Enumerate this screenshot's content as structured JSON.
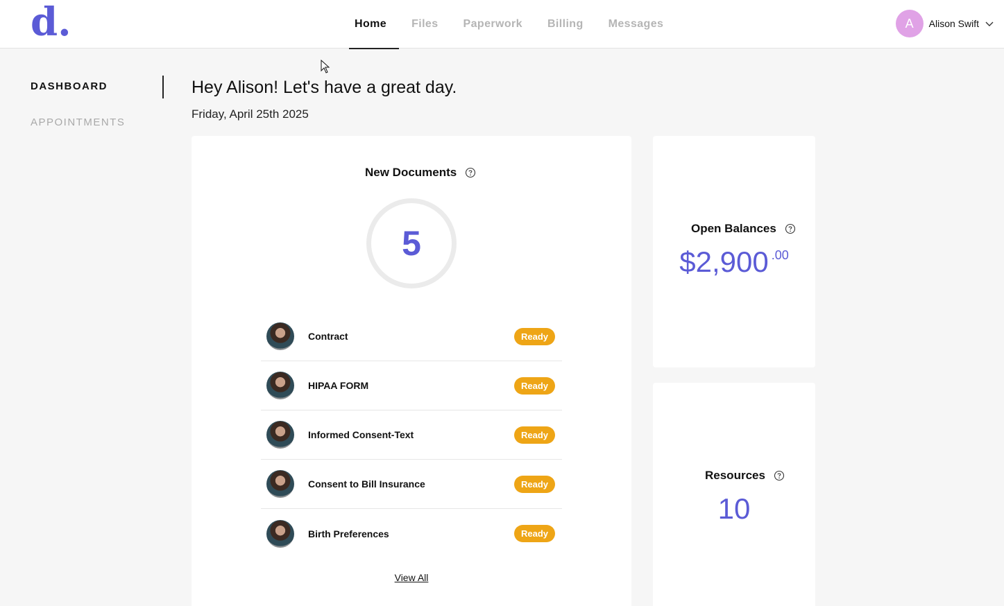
{
  "app": {
    "logo_text": "d."
  },
  "nav": {
    "items": [
      {
        "label": "Home",
        "active": true
      },
      {
        "label": "Files",
        "active": false
      },
      {
        "label": "Paperwork",
        "active": false
      },
      {
        "label": "Billing",
        "active": false
      },
      {
        "label": "Messages",
        "active": false
      }
    ]
  },
  "user": {
    "initial": "A",
    "name": "Alison Swift",
    "avatar_color": "#e0a2e6"
  },
  "sidebar": {
    "items": [
      {
        "label": "DASHBOARD",
        "active": true
      },
      {
        "label": "APPOINTMENTS",
        "active": false
      }
    ]
  },
  "greeting": {
    "headline": "Hey Alison! Let's have a great day.",
    "date": "Friday, April 25th 2025"
  },
  "documents": {
    "title": "New Documents",
    "count": "5",
    "items": [
      {
        "name": "Contract",
        "status": "Ready"
      },
      {
        "name": "HIPAA FORM",
        "status": "Ready"
      },
      {
        "name": "Informed Consent-Text",
        "status": "Ready"
      },
      {
        "name": "Consent to Bill Insurance",
        "status": "Ready"
      },
      {
        "name": "Birth Preferences",
        "status": "Ready"
      }
    ],
    "view_all": "View All"
  },
  "balances": {
    "title": "Open Balances",
    "amount": "$2,900",
    "cents": ".00"
  },
  "resources": {
    "title": "Resources",
    "count": "10"
  },
  "colors": {
    "accent": "#5b5bd6",
    "badge": "#eea516",
    "background": "#f6f6f6"
  }
}
